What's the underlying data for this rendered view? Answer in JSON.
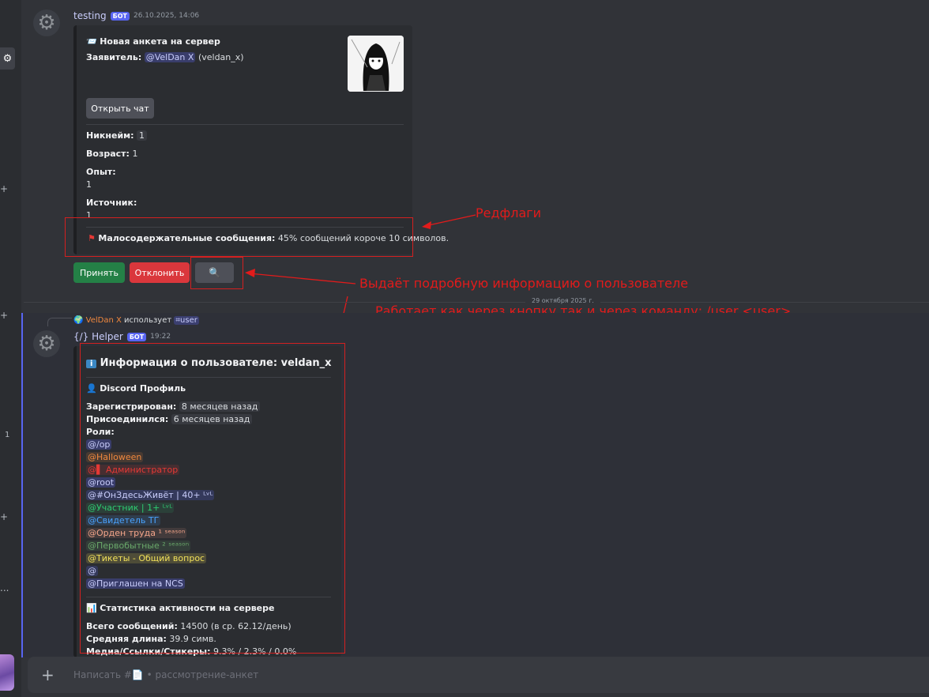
{
  "rail": {
    "badge": "1",
    "dots": "..."
  },
  "msg1": {
    "author": "testing",
    "bot_badge": "БОТ",
    "timestamp": "26.10.2025, 14:06",
    "embed": {
      "title_icon": "📨",
      "title": "Новая анкета на сервер",
      "applicant_label": "Заявитель:",
      "applicant_mention": "@VelDan X",
      "applicant_handle": "(veldan_x)",
      "open_chat": "Открыть чат",
      "fields": [
        {
          "label": "Никнейм:",
          "value": "1",
          "inline": true,
          "code": true
        },
        {
          "label": "Возраст:",
          "value": "1",
          "inline": true,
          "code": false
        },
        {
          "label": "Опыт:",
          "value": "1",
          "inline": false,
          "code": false
        },
        {
          "label": "Источник:",
          "value": "1",
          "inline": false,
          "code": false
        }
      ],
      "flag_label": "Малосодержательные сообщения:",
      "flag_value": "45% сообщений короче 10 символов."
    },
    "buttons": {
      "accept": "Принять",
      "reject": "Отклонить"
    }
  },
  "divider_date": "29 октября 2025 г.",
  "msg2": {
    "reply_user": "VelDan X",
    "reply_text": "использует",
    "reply_command": "user",
    "author": "{/} Helper",
    "bot_badge": "БОТ",
    "timestamp": "19:22",
    "embed": {
      "title": "Информация о пользователе: veldan_x",
      "profile_heading": "Discord Профиль",
      "registered_label": "Зарегистрирован:",
      "registered_value": "8 месяцев назад",
      "joined_label": "Присоединился:",
      "joined_value": "6 месяцев назад",
      "roles_label": "Роли:",
      "roles": [
        {
          "text": "@/op",
          "color": "#c9cdfb",
          "bg": "rgba(88,101,242,.3)"
        },
        {
          "text": "@Halloween",
          "color": "#f0883e",
          "bg": "rgba(240,136,62,.15)"
        },
        {
          "text": "@▌ Администратор",
          "color": "#e53935",
          "bg": "rgba(229,57,53,.15)"
        },
        {
          "text": "@root",
          "color": "#c9cdfb",
          "bg": "rgba(88,101,242,.3)"
        },
        {
          "text": "@#ОнЗдесьЖивёт | 40+ ᴸᵛᴸ",
          "color": "#c9cdfb",
          "bg": "rgba(88,101,242,.22)"
        },
        {
          "text": "@Участник | 1+ ᴸᵛᴸ",
          "color": "#2ecc71",
          "bg": "rgba(46,204,113,.12)"
        },
        {
          "text": "@Свидетель ТГ",
          "color": "#4aa3ff",
          "bg": "rgba(74,163,255,.15)"
        },
        {
          "text": "@Орден труда ¹ ˢᵉᵃˢᵒⁿ",
          "color": "#f4a58a",
          "bg": "rgba(244,165,138,.12)"
        },
        {
          "text": "@Первобытные ² ˢᵉᵃˢᵒⁿ",
          "color": "#6aa86a",
          "bg": "rgba(106,168,106,.14)"
        },
        {
          "text": "@Тикеты - Общий вопрос",
          "color": "#f1e05a",
          "bg": "rgba(241,224,90,.18)"
        },
        {
          "text": "@",
          "color": "#c9cdfb",
          "bg": "rgba(88,101,242,.22)"
        },
        {
          "text": "@Приглашен на NCS",
          "color": "#c9cdfb",
          "bg": "rgba(88,101,242,.3)"
        }
      ],
      "stats_heading": "Статистика активности на сервере",
      "total_label": "Всего сообщений:",
      "total_value": "14500 (в ср. 62.12/день)",
      "avg_label": "Средняя длина:",
      "avg_value": "39.9 симв.",
      "media_label": "Медиа/Ссылки/Стикеры:",
      "media_value": "9.3% / 2.3% / 0.0%"
    }
  },
  "annotations": {
    "redflags": "Редфлаги",
    "info_line1": "Выдаёт подробную информацию о пользователе",
    "info_line2": "Работает как через кнопку так и через команду: /user <user>"
  },
  "composer": {
    "placeholder": "Написать #📄 • рассмотрение-анкет"
  },
  "colors": {
    "annotation": "#e21b1b",
    "accept": "#248046",
    "reject": "#da373c",
    "bot": "#5865f2"
  }
}
